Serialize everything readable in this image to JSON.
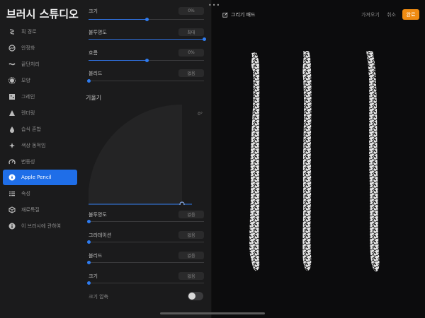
{
  "app": {
    "title": "브러시 스튜디오"
  },
  "sidebar": {
    "items": [
      {
        "label": "획 경로",
        "icon": "stroke-path-icon",
        "active": false
      },
      {
        "label": "안정화",
        "icon": "stabilization-icon",
        "active": false
      },
      {
        "label": "끝단처리",
        "icon": "taper-icon",
        "active": false
      },
      {
        "label": "모양",
        "icon": "shape-icon",
        "active": false
      },
      {
        "label": "그레인",
        "icon": "grain-icon",
        "active": false
      },
      {
        "label": "렌더링",
        "icon": "rendering-icon",
        "active": false
      },
      {
        "label": "습식 혼합",
        "icon": "wet-mix-icon",
        "active": false
      },
      {
        "label": "색상 동적임",
        "icon": "color-dynamics-icon",
        "active": false
      },
      {
        "label": "변동성",
        "icon": "dynamics-icon",
        "active": false
      },
      {
        "label": "Apple Pencil",
        "icon": "apple-pencil-icon",
        "active": true
      },
      {
        "label": "속성",
        "icon": "properties-icon",
        "active": false
      },
      {
        "label": "재료특질",
        "icon": "materials-icon",
        "active": false
      },
      {
        "label": "이 브러시에 관하여",
        "icon": "info-icon",
        "active": false
      }
    ]
  },
  "panel": {
    "pressure": [
      {
        "label": "크기",
        "value": "0%",
        "level": 0.5
      },
      {
        "label": "불투명도",
        "value": "최대",
        "level": 1.0
      },
      {
        "label": "흐름",
        "value": "0%",
        "level": 0.5
      },
      {
        "label": "블리드",
        "value": "없음",
        "level": 0.0
      }
    ],
    "tilt": {
      "heading": "기울기",
      "angle": "0°",
      "rows": [
        {
          "label": "불투명도",
          "value": "없음",
          "level": 0.0
        },
        {
          "label": "그라데이션",
          "value": "없음",
          "level": 0.0
        },
        {
          "label": "블리드",
          "value": "없음",
          "level": 0.0
        },
        {
          "label": "크기",
          "value": "없음",
          "level": 0.0
        }
      ]
    },
    "size_compression": {
      "label": "크기 압축",
      "on": false
    }
  },
  "canvas": {
    "drawing_pad_label": "그리기 패드",
    "import_label": "가져오기",
    "cancel_label": "취소",
    "done_label": "완료"
  },
  "colors": {
    "accent": "#1f6ee8",
    "done": "#ef8b12"
  }
}
